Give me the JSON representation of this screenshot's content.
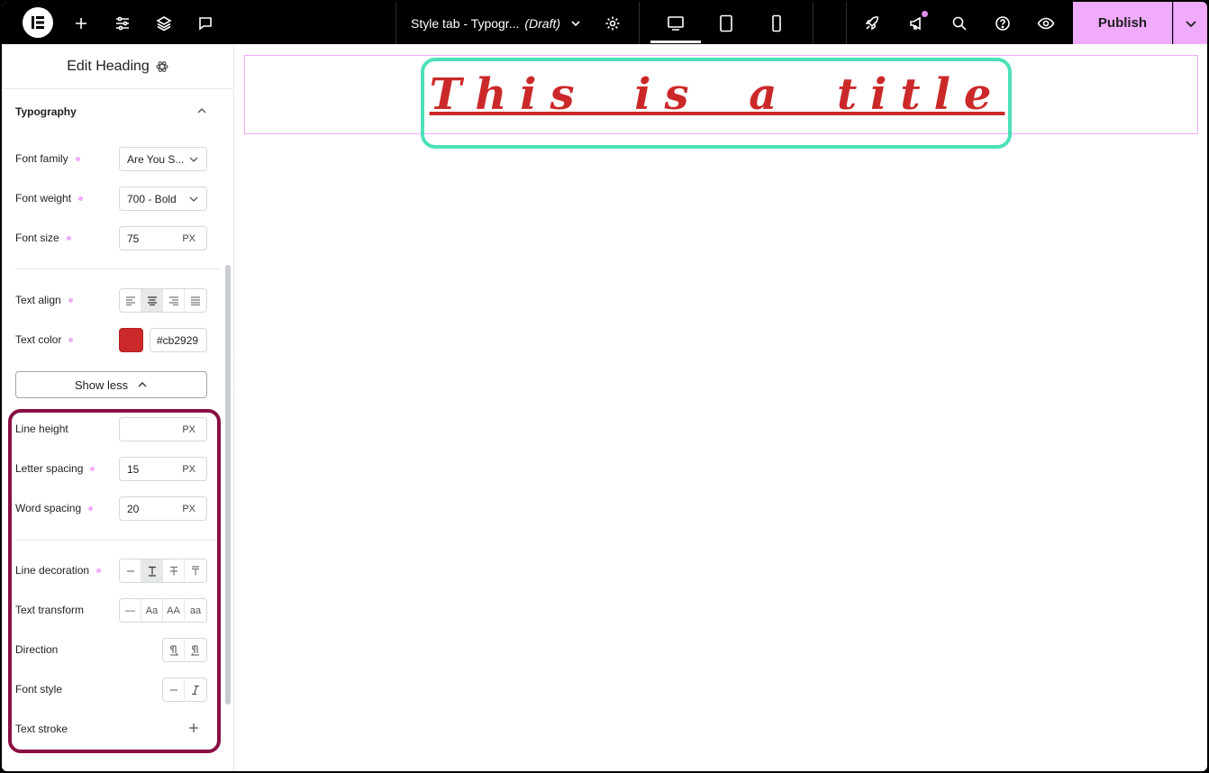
{
  "topbar": {
    "doc_title": "Style tab - Typogr...",
    "doc_status": "(Draft)",
    "publish_label": "Publish"
  },
  "panel": {
    "title": "Edit Heading",
    "section": "Typography",
    "font_family": {
      "label": "Font family",
      "value": "Are You S..."
    },
    "font_weight": {
      "label": "Font weight",
      "value": "700 - Bold"
    },
    "font_size": {
      "label": "Font size",
      "value": "75",
      "unit": "PX"
    },
    "text_align": {
      "label": "Text align"
    },
    "text_color": {
      "label": "Text color",
      "value": "#cb2929"
    },
    "show_less": "Show less",
    "line_height": {
      "label": "Line height",
      "value": "",
      "unit": "PX"
    },
    "letter_spacing": {
      "label": "Letter spacing",
      "value": "15",
      "unit": "PX"
    },
    "word_spacing": {
      "label": "Word spacing",
      "value": "20",
      "unit": "PX"
    },
    "line_decoration": {
      "label": "Line decoration"
    },
    "text_transform": {
      "label": "Text transform",
      "options": [
        "—",
        "Aa",
        "AA",
        "aa"
      ]
    },
    "direction": {
      "label": "Direction"
    },
    "font_style": {
      "label": "Font style"
    },
    "text_stroke": {
      "label": "Text stroke"
    }
  },
  "canvas": {
    "heading": "This is a title"
  },
  "colors": {
    "accent": "#f0abfc",
    "text_color": "#cb2929",
    "highlight_teal": "#4ee0b8",
    "highlight_maroon": "#8a0e45"
  }
}
